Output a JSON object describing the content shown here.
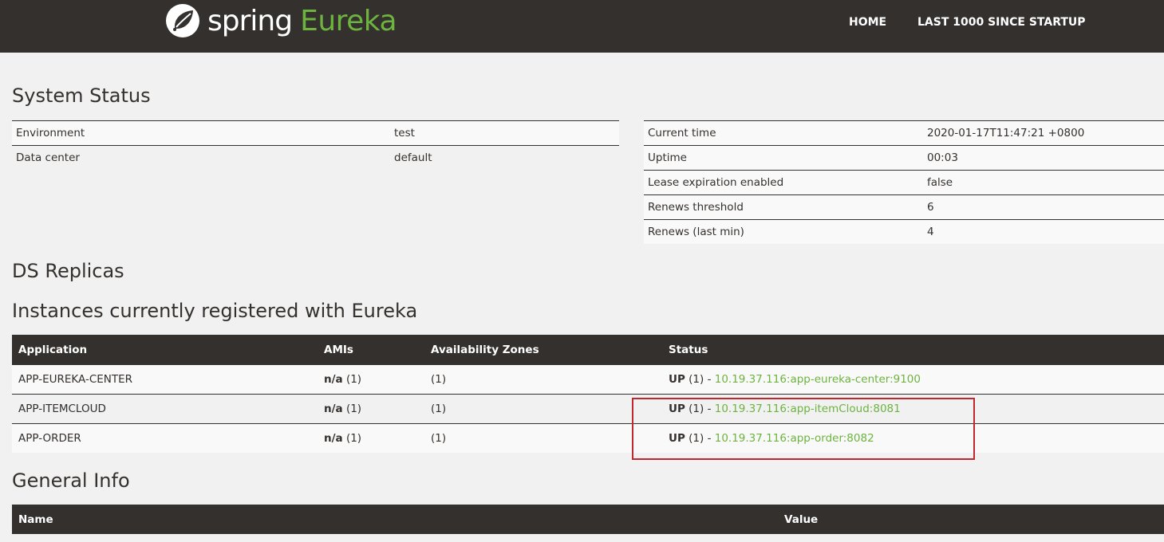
{
  "header": {
    "logo_spring": "spring",
    "logo_eureka": "Eureka",
    "nav_home": "HOME",
    "nav_last": "LAST 1000 SINCE STARTUP"
  },
  "system_status": {
    "title": "System Status",
    "left": [
      {
        "key": "Environment",
        "value": "test"
      },
      {
        "key": "Data center",
        "value": "default"
      }
    ],
    "right": [
      {
        "key": "Current time",
        "value": "2020-01-17T11:47:21 +0800"
      },
      {
        "key": "Uptime",
        "value": "00:03"
      },
      {
        "key": "Lease expiration enabled",
        "value": "false"
      },
      {
        "key": "Renews threshold",
        "value": "6"
      },
      {
        "key": "Renews (last min)",
        "value": "4"
      }
    ]
  },
  "ds_replicas": {
    "title": "DS Replicas"
  },
  "instances": {
    "title": "Instances currently registered with Eureka",
    "columns": [
      "Application",
      "AMIs",
      "Availability Zones",
      "Status"
    ],
    "rows": [
      {
        "application": "APP-EUREKA-CENTER",
        "amis_bold": "n/a",
        "amis_count": " (1)",
        "zones": "(1)",
        "status_bold": "UP",
        "status_count": " (1) - ",
        "status_link": "10.19.37.116:app-eureka-center:9100"
      },
      {
        "application": "APP-ITEMCLOUD",
        "amis_bold": "n/a",
        "amis_count": " (1)",
        "zones": "(1)",
        "status_bold": "UP",
        "status_count": " (1) - ",
        "status_link": "10.19.37.116:app-itemCloud:8081"
      },
      {
        "application": "APP-ORDER",
        "amis_bold": "n/a",
        "amis_count": " (1)",
        "zones": "(1)",
        "status_bold": "UP",
        "status_count": " (1) - ",
        "status_link": "10.19.37.116:app-order:8082"
      }
    ]
  },
  "general_info": {
    "title": "General Info",
    "columns": [
      "Name",
      "Value"
    ]
  },
  "colors": {
    "header_bg": "#34302d",
    "accent_green": "#6db33f",
    "page_bg": "#f1f1f1",
    "highlight_red": "#c0282d"
  }
}
